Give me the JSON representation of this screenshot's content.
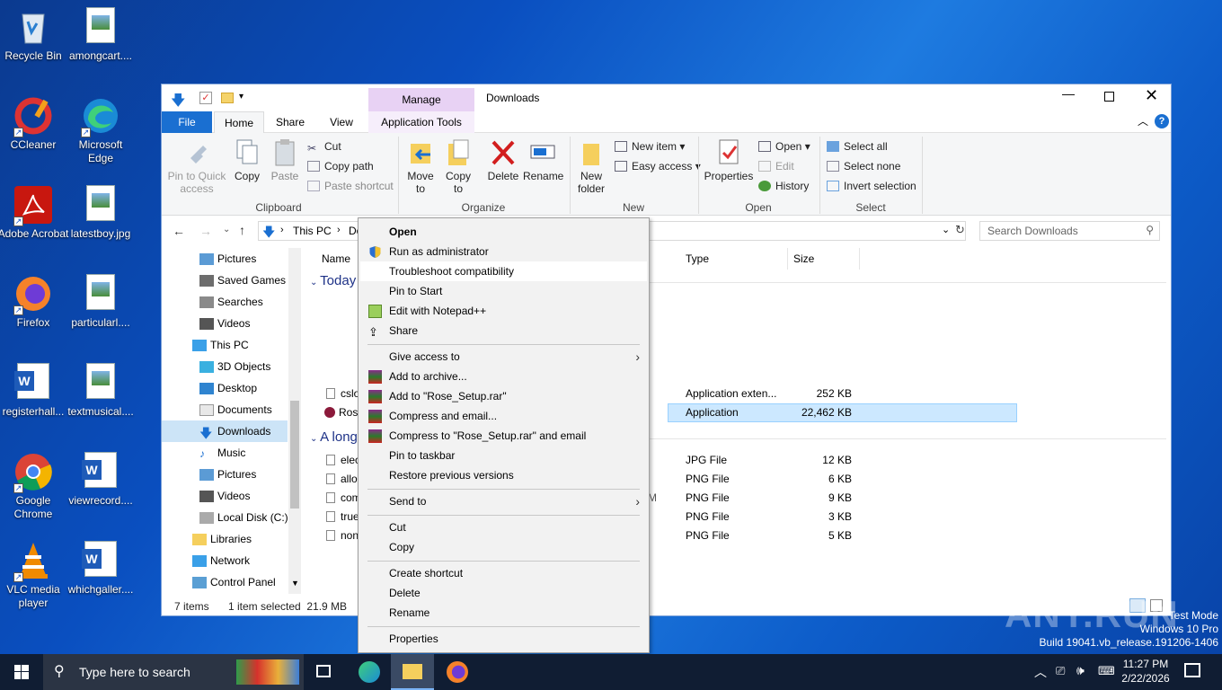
{
  "desktop": {
    "icons": [
      {
        "label": "Recycle Bin",
        "icon": "recycle-bin-icon"
      },
      {
        "label": "amongcart....",
        "icon": "image-file-icon"
      },
      {
        "label": "CCleaner",
        "icon": "ccleaner-icon"
      },
      {
        "label": "Microsoft Edge",
        "icon": "edge-icon"
      },
      {
        "label": "Adobe Acrobat",
        "icon": "acrobat-icon"
      },
      {
        "label": "latestboy.jpg",
        "icon": "image-file-icon"
      },
      {
        "label": "Firefox",
        "icon": "firefox-icon"
      },
      {
        "label": "particularl....",
        "icon": "image-file-icon"
      },
      {
        "label": "registerhall...",
        "icon": "word-doc-icon"
      },
      {
        "label": "textmusical....",
        "icon": "image-file-icon"
      },
      {
        "label": "Google Chrome",
        "icon": "chrome-icon"
      },
      {
        "label": "viewrecord....",
        "icon": "word-doc-icon"
      },
      {
        "label": "VLC media player",
        "icon": "vlc-icon"
      },
      {
        "label": "whichgaller....",
        "icon": "word-doc-icon"
      }
    ]
  },
  "explorer": {
    "title": "Downloads",
    "context_tab": "Manage",
    "tabs": [
      "File",
      "Home",
      "Share",
      "View",
      "Application Tools"
    ],
    "ribbon": {
      "clipboard": {
        "pin": "Pin to Quick access",
        "copy": "Copy",
        "paste": "Paste",
        "cut": "Cut",
        "copy_path": "Copy path",
        "paste_shortcut": "Paste shortcut",
        "group": "Clipboard"
      },
      "organize": {
        "move": "Move to",
        "copy": "Copy to",
        "delete": "Delete",
        "rename": "Rename",
        "group": "Organize"
      },
      "new": {
        "folder": "New folder",
        "item": "New item",
        "easy": "Easy access",
        "group": "New"
      },
      "open": {
        "properties": "Properties",
        "open": "Open",
        "edit": "Edit",
        "history": "History",
        "group": "Open"
      },
      "select": {
        "all": "Select all",
        "none": "Select none",
        "invert": "Invert selection",
        "group": "Select"
      }
    },
    "address": {
      "crumbs": [
        "This PC",
        "Do"
      ],
      "search_placeholder": "Search Downloads"
    },
    "nav": [
      "Pictures",
      "Saved Games",
      "Searches",
      "Videos",
      "This PC",
      "3D Objects",
      "Desktop",
      "Documents",
      "Downloads",
      "Music",
      "Pictures",
      "Videos",
      "Local Disk (C:)",
      "Libraries",
      "Network",
      "Control Panel"
    ],
    "columns": {
      "name": "Name",
      "type": "Type",
      "size": "Size"
    },
    "groups": {
      "today": "Today",
      "long": "A long"
    },
    "files": [
      {
        "name": "cslo",
        "type": "Application exten...",
        "size": "252 KB"
      },
      {
        "name": "Ros",
        "type": "Application",
        "size": "22,462 KB"
      },
      {
        "name": "elec",
        "type": "JPG File",
        "size": "12 KB"
      },
      {
        "name": "allo",
        "type": "PNG File",
        "size": "6 KB"
      },
      {
        "name": "com",
        "type": "PNG File",
        "size": "9 KB"
      },
      {
        "name": "true",
        "type": "PNG File",
        "size": "3 KB"
      },
      {
        "name": "non",
        "type": "PNG File",
        "size": "5 KB"
      }
    ],
    "status": {
      "count": "7 items",
      "selected": "1 item selected  21.9 MB"
    },
    "date_fragment": "M"
  },
  "context_menu": [
    "Open",
    "Run as administrator",
    "Troubleshoot compatibility",
    "Pin to Start",
    "Edit with Notepad++",
    "Share",
    "Give access to",
    "Add to archive...",
    "Add to \"Rose_Setup.rar\"",
    "Compress and email...",
    "Compress to \"Rose_Setup.rar\" and email",
    "Pin to taskbar",
    "Restore previous versions",
    "Send to",
    "Cut",
    "Copy",
    "Create shortcut",
    "Delete",
    "Rename",
    "Properties"
  ],
  "taskbar": {
    "search_placeholder": "Type here to search",
    "time": "11:27 PM",
    "date": "2/22/2026"
  },
  "watermark": {
    "line1": "Test Mode",
    "line2": "Windows 10 Pro",
    "line3": "Build 19041.vb_release.191206-1406",
    "brand": "ANY.RUN"
  }
}
